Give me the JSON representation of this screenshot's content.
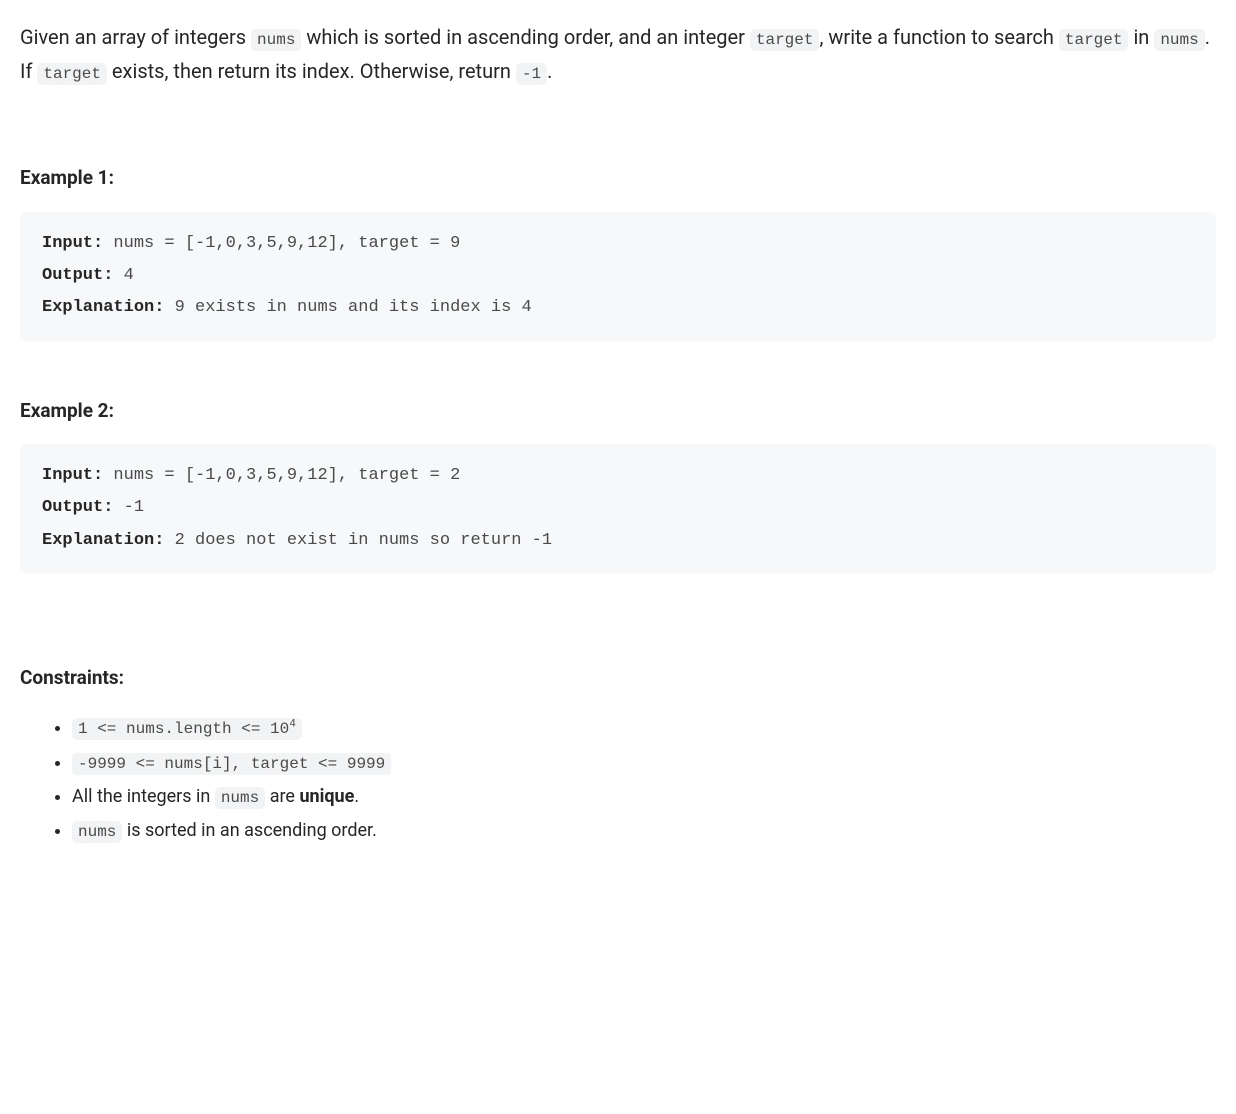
{
  "description": {
    "text1": "Given an array of integers ",
    "code1": "nums",
    "text2": " which is sorted in ascending order, and an integer ",
    "code2": "target",
    "text3": ", write a function to search ",
    "code3": "target",
    "text4": " in ",
    "code4": "nums",
    "text5": ". If ",
    "code5": "target",
    "text6": " exists, then return its index. Otherwise, return ",
    "code6": "-1",
    "text7": "."
  },
  "examples": [
    {
      "heading": "Example 1:",
      "input_label": "Input:",
      "input_value": " nums = [-1,0,3,5,9,12], target = 9",
      "output_label": "Output:",
      "output_value": " 4",
      "explanation_label": "Explanation:",
      "explanation_value": " 9 exists in nums and its index is 4"
    },
    {
      "heading": "Example 2:",
      "input_label": "Input:",
      "input_value": " nums = [-1,0,3,5,9,12], target = 2",
      "output_label": "Output:",
      "output_value": " -1",
      "explanation_label": "Explanation:",
      "explanation_value": " 2 does not exist in nums so return -1"
    }
  ],
  "constraints": {
    "heading": "Constraints:",
    "items": [
      {
        "code_full": "1 <= nums.length <= 10",
        "sup": "4"
      },
      {
        "code_full": "-9999 <= nums[i], target <= 9999"
      },
      {
        "text_before": "All the integers in ",
        "code": "nums",
        "text_after": " are ",
        "bold": "unique",
        "text_end": "."
      },
      {
        "code": "nums",
        "text_after": " is sorted in an ascending order."
      }
    ]
  }
}
